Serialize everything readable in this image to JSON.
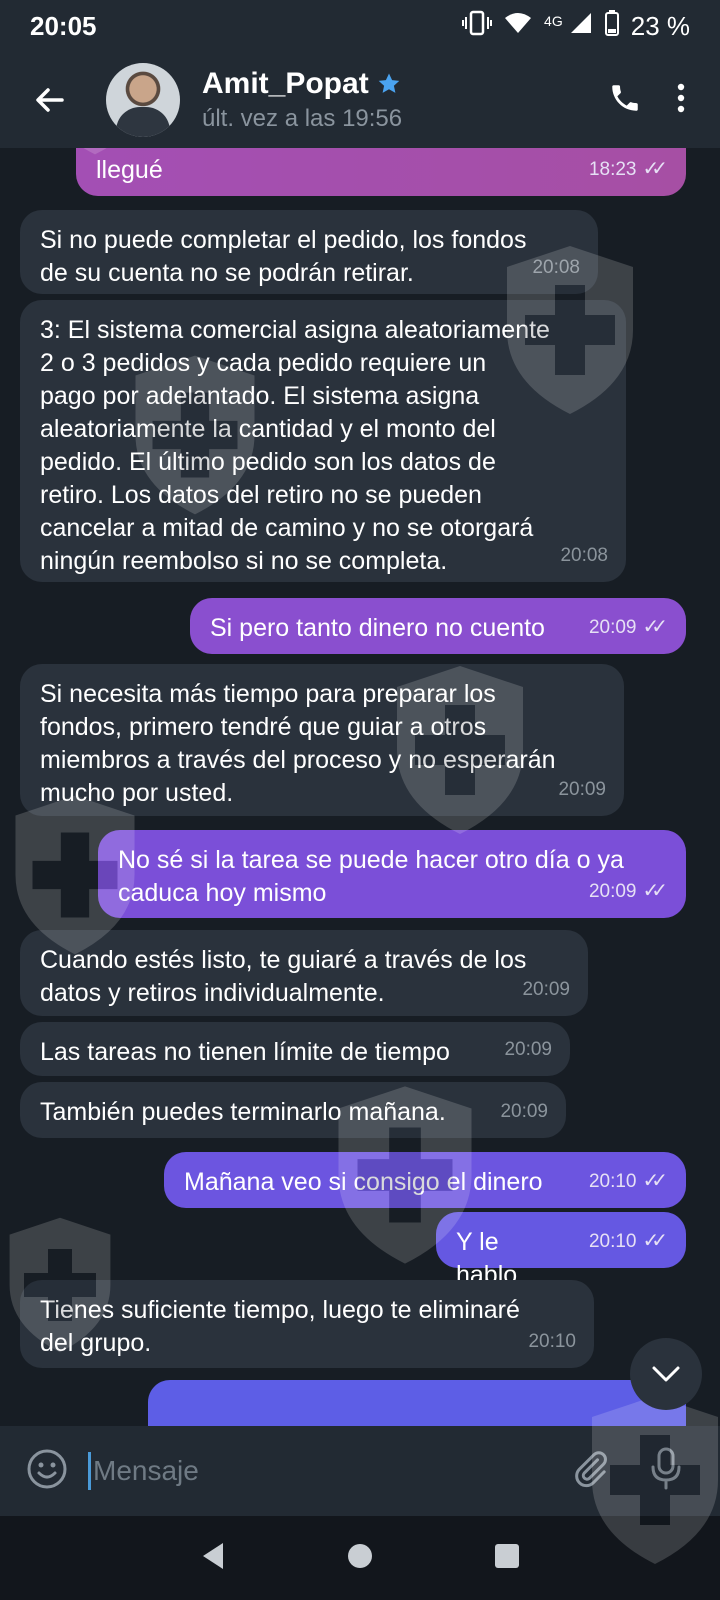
{
  "status_bar": {
    "time": "20:05",
    "network": "4G",
    "battery": "23 %"
  },
  "header": {
    "contact_name": "Amit_Popat",
    "last_seen": "últ. vez a las 19:56",
    "verified_color": "#4aa3f0"
  },
  "messages": [
    {
      "direction": "out",
      "text": "llegué",
      "time": "18:23",
      "read": true
    },
    {
      "direction": "in",
      "text": "Si no puede completar el pedido, los fondos\nde su cuenta no se podrán retirar.",
      "time": "20:08"
    },
    {
      "direction": "in",
      "text": "3: El sistema comercial asigna aleatoriamente\n2 o 3 pedidos y cada pedido requiere un\npago por adelantado. El sistema asigna\naleatoriamente la cantidad y el monto del\npedido. El último pedido son los datos de\nretiro. Los datos del retiro no se pueden\ncancelar a mitad de camino y no se otorgará\nningún reembolso si no se completa.",
      "time": "20:08"
    },
    {
      "direction": "out",
      "text": "Si pero tanto dinero no cuento",
      "time": "20:09",
      "read": true
    },
    {
      "direction": "in",
      "text": "Si necesita más tiempo para preparar los\nfondos, primero tendré que guiar a otros\nmiembros a través del proceso y no esperarán\nmucho por usted.",
      "time": "20:09"
    },
    {
      "direction": "out",
      "text": "No sé si la tarea se puede hacer otro día o ya\ncaduca hoy mismo",
      "time": "20:09",
      "read": true
    },
    {
      "direction": "in",
      "text": "Cuando estés listo, te guiaré a través de los\ndatos y retiros individualmente.",
      "time": "20:09"
    },
    {
      "direction": "in",
      "text": "Las tareas no tienen límite de tiempo",
      "time": "20:09"
    },
    {
      "direction": "in",
      "text": "También puedes terminarlo mañana.",
      "time": "20:09"
    },
    {
      "direction": "out",
      "text": "Mañana veo si consigo el dinero",
      "time": "20:10",
      "read": true
    },
    {
      "direction": "out",
      "text": "Y le hablo",
      "time": "20:10",
      "read": true
    },
    {
      "direction": "in",
      "text": "Tienes suficiente tiempo, luego te eliminaré\ndel grupo.",
      "time": "20:10"
    }
  ],
  "input": {
    "placeholder": "Mensaje",
    "value": ""
  },
  "icons": {
    "back": "arrow-left-icon",
    "call": "phone-icon",
    "menu": "more-vertical-icon",
    "emoji": "emoji-icon",
    "attach": "paperclip-icon",
    "mic": "microphone-icon",
    "scroll": "chevron-down-icon"
  }
}
